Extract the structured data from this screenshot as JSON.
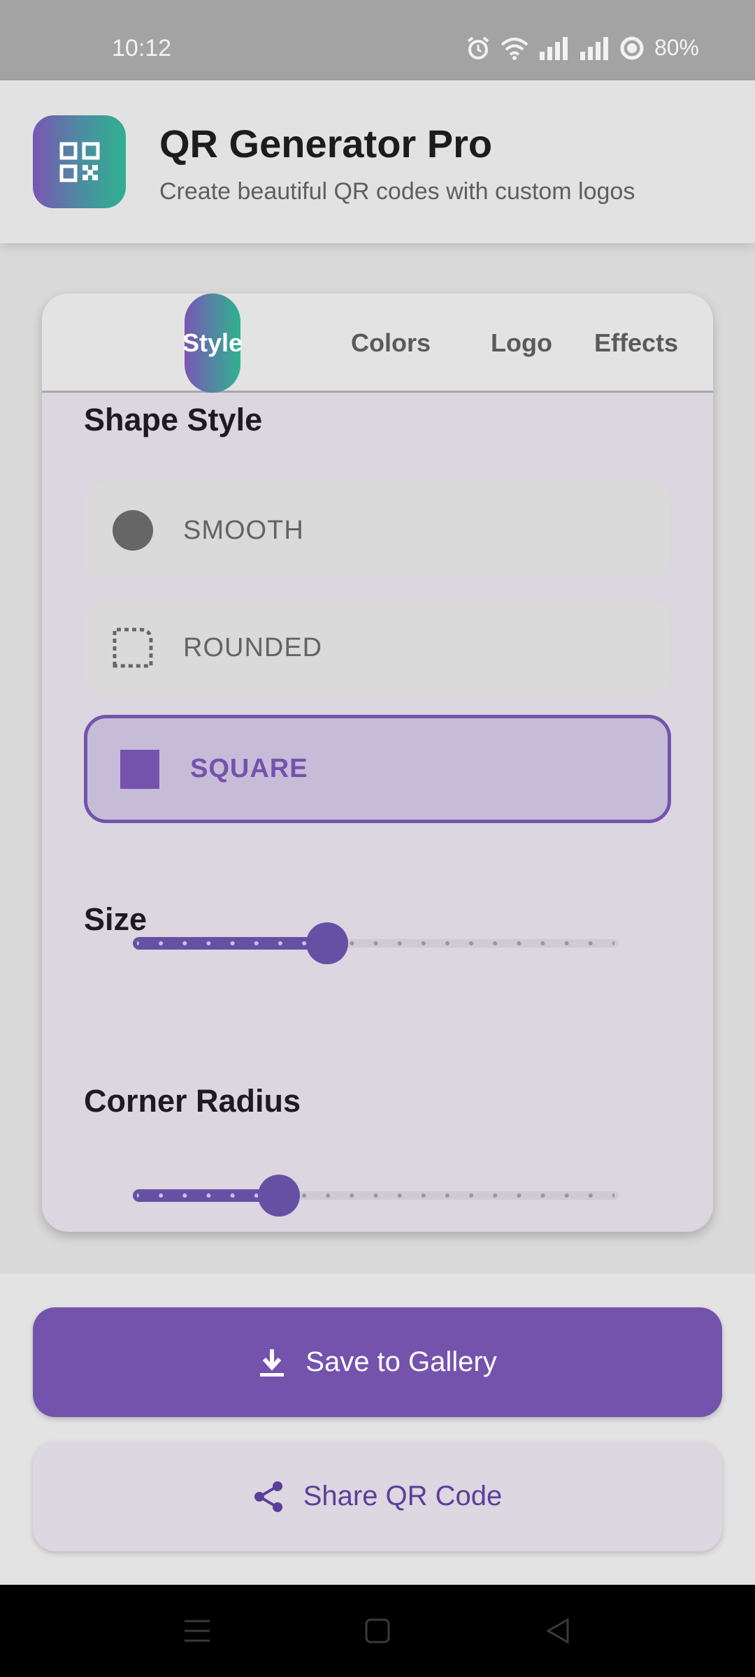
{
  "status_bar": {
    "time": "10:12",
    "battery": "80%",
    "icons": [
      "alarm-icon",
      "wifi-icon",
      "signal-icon",
      "signal-icon",
      "battery-icon"
    ]
  },
  "header": {
    "title": "QR Generator Pro",
    "subtitle": "Create beautiful QR codes with custom logos",
    "logo_icon": "qr-code-icon"
  },
  "tabs": [
    {
      "label": "Style",
      "active": true
    },
    {
      "label": "Colors",
      "active": false
    },
    {
      "label": "Logo",
      "active": false
    },
    {
      "label": "Effects",
      "active": false
    }
  ],
  "shape_style": {
    "title": "Shape Style",
    "options": [
      {
        "label": "SMOOTH",
        "icon": "circle-icon",
        "selected": false
      },
      {
        "label": "ROUNDED",
        "icon": "rounded-corner-icon",
        "selected": false
      },
      {
        "label": "SQUARE",
        "icon": "square-icon",
        "selected": true
      }
    ]
  },
  "size": {
    "title": "Size",
    "value_fraction": 0.4
  },
  "corner_radius": {
    "title": "Corner Radius",
    "value_fraction": 0.3
  },
  "actions": {
    "save_label": "Save to Gallery",
    "share_label": "Share QR Code"
  },
  "colors": {
    "accent": "#7453ad",
    "slider": "#6650a4",
    "gradient_start": "#7a56b3",
    "gradient_end": "#2fb18e"
  }
}
